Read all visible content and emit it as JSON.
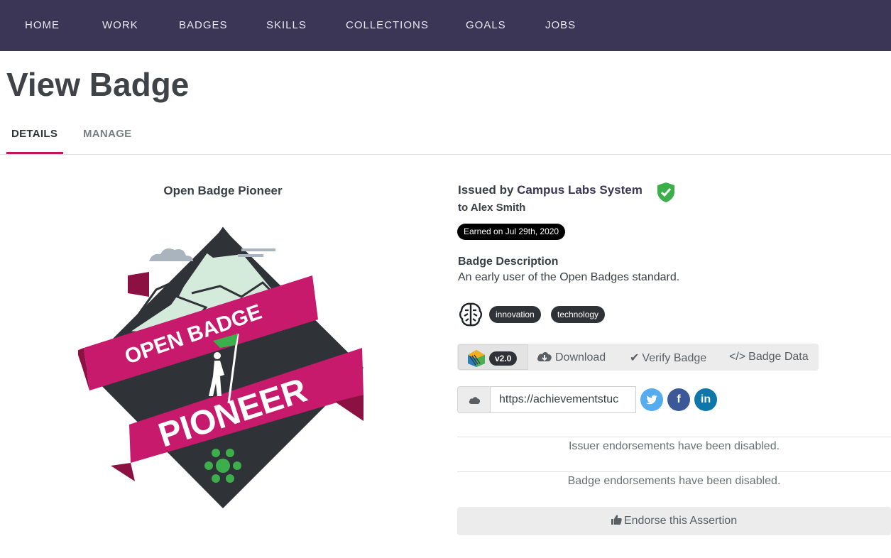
{
  "nav": {
    "items": [
      "HOME",
      "WORK",
      "BADGES",
      "SKILLS",
      "COLLECTIONS",
      "GOALS",
      "JOBS"
    ]
  },
  "page": {
    "title": "View Badge"
  },
  "tabs": [
    {
      "label": "DETAILS",
      "active": true
    },
    {
      "label": "MANAGE",
      "active": false
    }
  ],
  "badge": {
    "name": "Open Badge Pioneer",
    "image_text": {
      "ribbon_top": "OPEN BADGE",
      "ribbon_bottom": "PIONEER"
    },
    "issued_prefix": "Issued by",
    "issuer": "Campus Labs System",
    "issuer_verified_icon": "verified-shield-icon",
    "recipient": "to Alex Smith",
    "earned": "Earned on Jul 29th, 2020",
    "description_label": "Badge Description",
    "description": "An early user of the Open Badges standard.",
    "tags": [
      "innovation",
      "technology"
    ],
    "tags_icon": "brain-icon"
  },
  "toolbar": {
    "version": "v2.0",
    "download": "Download",
    "verify": "Verify Badge",
    "badge_data": "Badge Data"
  },
  "share": {
    "url": "https://achievementstuc",
    "icons": [
      "cloud-icon",
      "twitter-icon",
      "facebook-icon",
      "linkedin-icon"
    ]
  },
  "endorsements": {
    "issuer_note": "Issuer endorsements have been disabled.",
    "badge_note": "Badge endorsements have been disabled.",
    "endorse_button": "Endorse this Assertion"
  },
  "colors": {
    "nav_bg": "#3b3556",
    "accent": "#c2185b",
    "verified": "#3cae4b",
    "twitter": "#55acee",
    "facebook": "#3b5998",
    "linkedin": "#0e76a8"
  }
}
